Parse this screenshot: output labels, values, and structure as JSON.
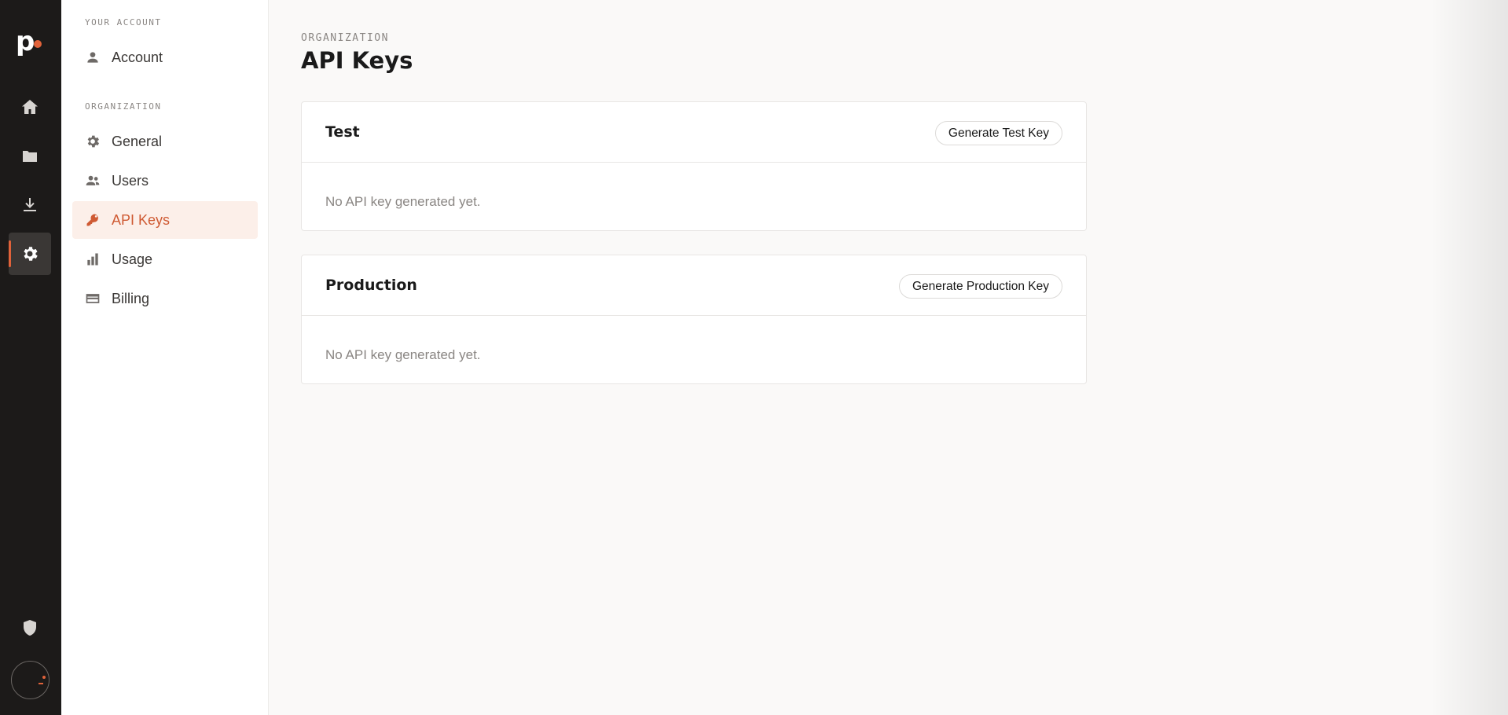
{
  "app": {
    "logo_text": "p",
    "colors": {
      "accent": "#e0623a",
      "rail": "#1c1a19",
      "active_bg": "#fcefe9"
    }
  },
  "rail": {
    "items": [
      {
        "icon": "home-icon"
      },
      {
        "icon": "folder-icon"
      },
      {
        "icon": "download-icon"
      },
      {
        "icon": "gear-icon",
        "active": true
      }
    ],
    "bottom": [
      {
        "icon": "shield-icon"
      },
      {
        "icon": "avatar"
      }
    ]
  },
  "sidebar": {
    "account_section": "YOUR ACCOUNT",
    "org_section": "ORGANIZATION",
    "items": {
      "account": "Account",
      "general": "General",
      "users": "Users",
      "api_keys": "API Keys",
      "usage": "Usage",
      "billing": "Billing"
    }
  },
  "main": {
    "eyebrow": "ORGANIZATION",
    "title": "API Keys",
    "cards": [
      {
        "title": "Test",
        "button": "Generate Test Key",
        "empty": "No API key generated yet."
      },
      {
        "title": "Production",
        "button": "Generate Production Key",
        "empty": "No API key generated yet."
      }
    ]
  }
}
